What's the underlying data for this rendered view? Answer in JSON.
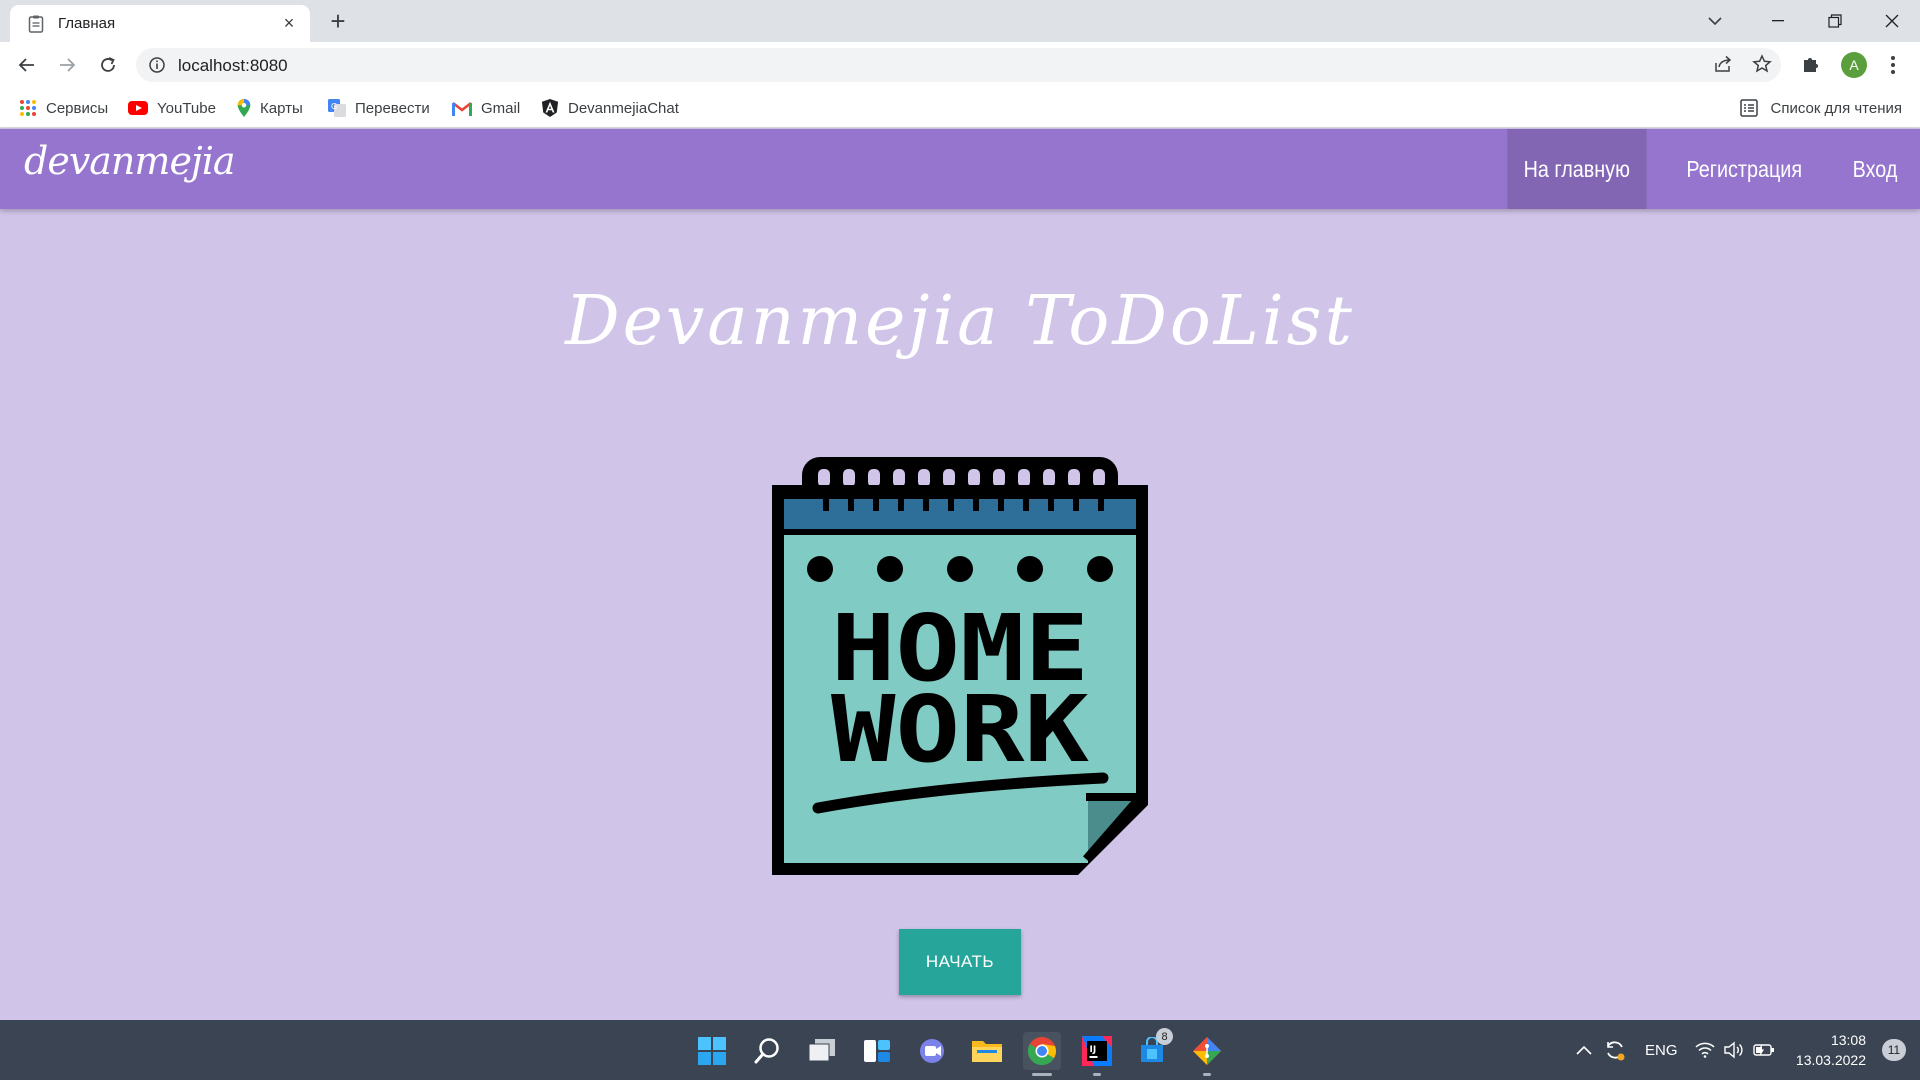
{
  "browser": {
    "tab_title": "Главная",
    "tab_close": "×",
    "new_tab": "+",
    "url": "localhost:8080",
    "profile_initial": "A",
    "bookmarks": [
      {
        "label": "Сервисы",
        "icon": "apps-grid-icon"
      },
      {
        "label": "YouTube",
        "icon": "youtube-icon"
      },
      {
        "label": "Карты",
        "icon": "maps-pin-icon"
      },
      {
        "label": "Перевести",
        "icon": "translate-icon"
      },
      {
        "label": "Gmail",
        "icon": "gmail-icon"
      },
      {
        "label": "DevanmejiaChat",
        "icon": "angular-icon"
      }
    ],
    "reading_list": "Список для чтения"
  },
  "page": {
    "brand": "devanmejia",
    "nav": [
      {
        "label": "На главную",
        "active": true
      },
      {
        "label": "Регистрация",
        "active": false
      },
      {
        "label": "Вход",
        "active": false
      }
    ],
    "title": "Devanmejia ToDoList",
    "illustration_text": [
      "HOME",
      "WORK"
    ],
    "start_button": "НАЧАТЬ",
    "colors": {
      "navbar": "#9575cd",
      "background": "#d1c4e9",
      "button": "#26a69a",
      "notebook_paper": "#80cbc4",
      "notebook_band": "#2e6f99"
    }
  },
  "taskbar": {
    "apps": [
      "start-icon",
      "search-icon",
      "task-view-icon",
      "widgets-icon",
      "chat-icon",
      "file-explorer-icon",
      "chrome-icon",
      "intellij-icon",
      "store-icon",
      "git-icon"
    ],
    "store_badge": "8",
    "language": "ENG",
    "time": "13:08",
    "date": "13.03.2022",
    "notifications": "11"
  }
}
